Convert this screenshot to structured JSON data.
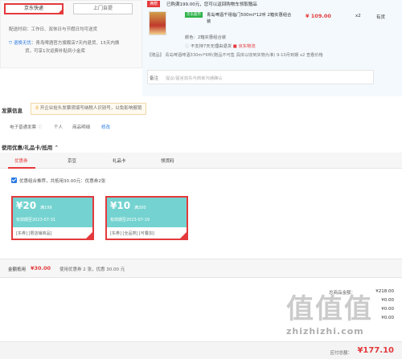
{
  "shipping": {
    "tabs": [
      "京东快递",
      "上门自提"
    ],
    "time_label": "配送时间：",
    "time_value": "工作日、双休日与节假日均可送货",
    "returns_tag": "退换无忧",
    "returns_text_1": "：青岛啤酒官方旗舰店7天内退货、15天内换",
    "returns_text_2": "货，可享1次运费补贴到小金库"
  },
  "cart": {
    "promo_tag": "满赠",
    "promo_text": "已购满199.00元，您可以返回购物车领取赠品",
    "jd_badge": "京东超市",
    "product_title": "青岛啤酒千禧临门500ml*12听 2箱实惠组合装",
    "price": "¥ 109.00",
    "quantity": "x2",
    "stock": "有货",
    "color_line": "颜色：2箱实惠组合装",
    "service_1": "不支持7天无理由退货",
    "service_2": "京东物流",
    "gift_line": "【赠品】 青岛啤酒啤酒330ml*6听(赠品不可售 具体以收到实物为准) 9-10月到期 x2  查看价格",
    "remark_label": "备注",
    "remark_placeholder": "提议/留言前先与商家沟通确认"
  },
  "invoice": {
    "title": "发票信息",
    "tip": "开企业抬头发票须填写纳税人识别号，以免影响报销",
    "items": [
      "电子普通发票",
      "个人",
      "商品明细",
      "修改"
    ]
  },
  "coupons": {
    "title": "使用优惠/礼品卡/抵用",
    "tabs": [
      "优惠券",
      "京豆",
      "礼品卡",
      "领货码"
    ],
    "combo_text": "优惠组合推荐，共抵用30.00元：优惠券2张",
    "list": [
      {
        "amount": "¥20",
        "condition": "满199",
        "expiry": "有效期至2023-07-31",
        "tags": "[东券] [限店铺商品]"
      },
      {
        "amount": "¥10",
        "condition": "满200",
        "expiry": "有效期至2023-07-19",
        "tags": "[东券] [全品类] [可叠加]"
      }
    ],
    "discount_label": "金额抵用",
    "discount_value": "¥30.00",
    "discount_summary": "使用优惠券 2 张，优惠 30.00 元"
  },
  "totals": {
    "rows": [
      {
        "label": "总商品金额：",
        "value": "¥218.00"
      },
      {
        "label": "",
        "value": "¥0.00"
      },
      {
        "label": "",
        "value": "¥0.00"
      },
      {
        "label": "",
        "value": "¥0.00"
      }
    ],
    "payable_label": "应付总额：",
    "payable_value": "¥177.10"
  },
  "watermark": {
    "site": "zhizhizhi.com",
    "brand": "值值值"
  },
  "colors": {
    "accent": "#e4393c",
    "coupon_bg": "#74d3d0",
    "jd_green": "#2db24a"
  }
}
